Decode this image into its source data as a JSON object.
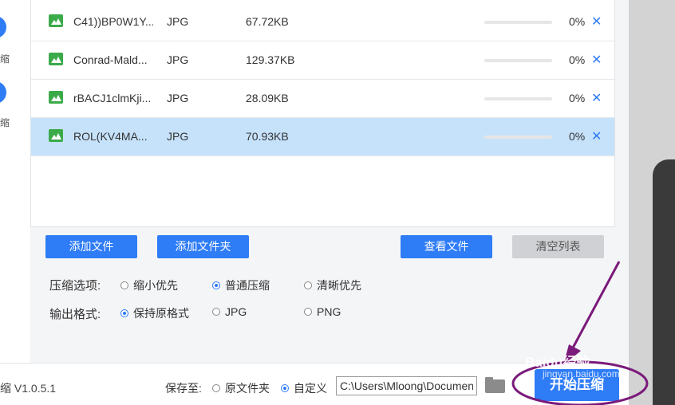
{
  "sidebar": {
    "labels": [
      "缩",
      "缩"
    ]
  },
  "files": [
    {
      "name": "C41))BP0W1Y...",
      "type": "JPG",
      "size": "67.72KB",
      "progress": "0%",
      "progress_fraction": 0,
      "selected": false
    },
    {
      "name": "Conrad-Mald...",
      "type": "JPG",
      "size": "129.37KB",
      "progress": "0%",
      "progress_fraction": 0,
      "selected": false
    },
    {
      "name": "rBACJ1clmKji...",
      "type": "JPG",
      "size": "28.09KB",
      "progress": "0%",
      "progress_fraction": 0,
      "selected": false
    },
    {
      "name": "ROL(KV4MA...",
      "type": "JPG",
      "size": "70.93KB",
      "progress": "0%",
      "progress_fraction": 0,
      "selected": true
    }
  ],
  "delete_symbol": "✕",
  "actions": {
    "add_file": "添加文件",
    "add_folder": "添加文件夹",
    "view_files": "查看文件",
    "clear_list": "清空列表"
  },
  "compression": {
    "label": "压缩选项:",
    "options": [
      "缩小优先",
      "普通压缩",
      "清晰优先"
    ],
    "selected": "普通压缩"
  },
  "output_format": {
    "label": "输出格式:",
    "options": [
      "保持原格式",
      "JPG",
      "PNG"
    ],
    "selected": "保持原格式"
  },
  "footer": {
    "version": "缩 V1.0.5.1",
    "save_to_label": "保存至:",
    "save_options": [
      "原文件夹",
      "自定义"
    ],
    "save_selected": "自定义",
    "path_value": "C:\\Users\\Mloong\\Documents",
    "start_button": "开始压缩"
  },
  "watermark": {
    "main": "Baidu经验",
    "sub": "jingyan.baidu.com"
  },
  "colors": {
    "accent": "#2e7cf6",
    "selected_row": "#c6e2fb",
    "annotation": "#7a1a7a"
  }
}
